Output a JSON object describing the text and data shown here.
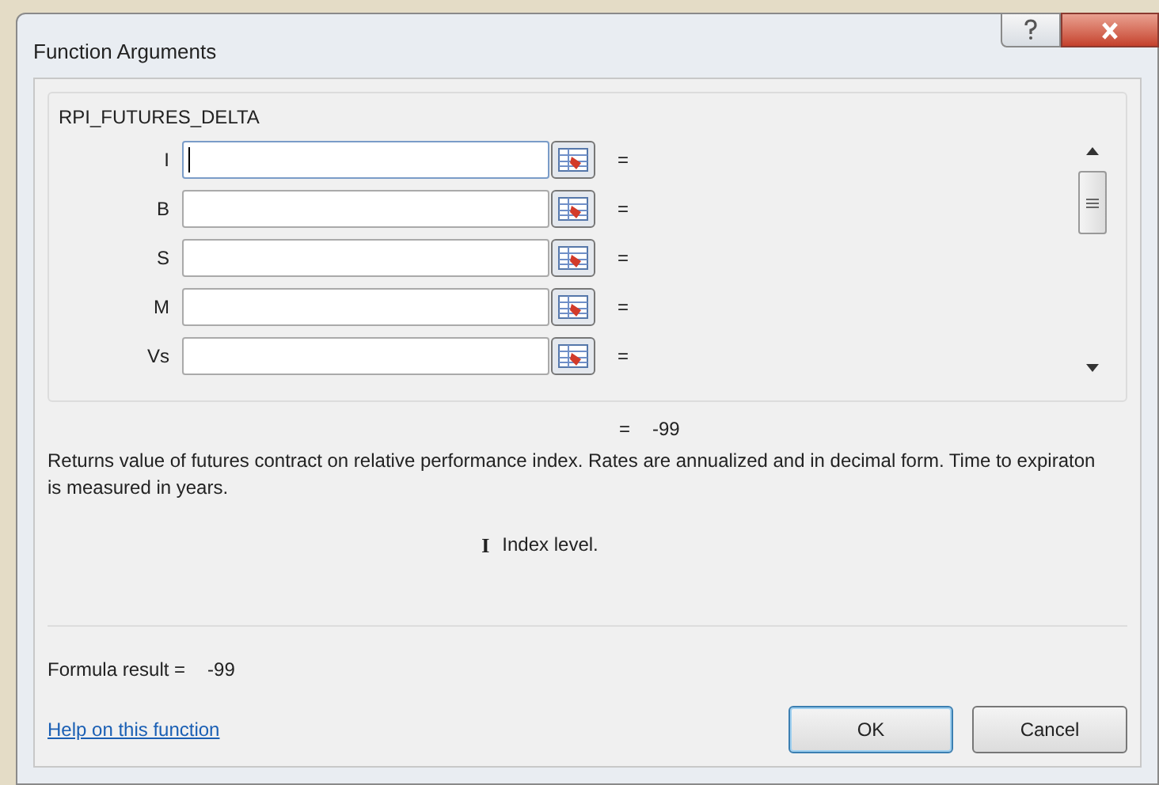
{
  "window": {
    "title": "Function Arguments"
  },
  "function_name": "RPI_FUTURES_DELTA",
  "arguments": [
    {
      "name": "I",
      "focused": true,
      "equals": "="
    },
    {
      "name": "B",
      "focused": false,
      "equals": "="
    },
    {
      "name": "S",
      "focused": false,
      "equals": "="
    },
    {
      "name": "M",
      "focused": false,
      "equals": "="
    },
    {
      "name": "Vs",
      "focused": false,
      "equals": "="
    }
  ],
  "result_preview": {
    "equals": "=",
    "value": "-99"
  },
  "description": "Returns value of futures contract on relative performance index. Rates are annualized and in decimal form.  Time to expiraton is measured in years.",
  "argument_help": {
    "name": "I",
    "text": "Index level."
  },
  "formula_result": {
    "label": "Formula result =",
    "value": "-99"
  },
  "help_link": "Help on this function",
  "buttons": [
    {
      "label": "OK",
      "kind": "default"
    },
    {
      "label": "Cancel",
      "kind": "normal"
    }
  ]
}
